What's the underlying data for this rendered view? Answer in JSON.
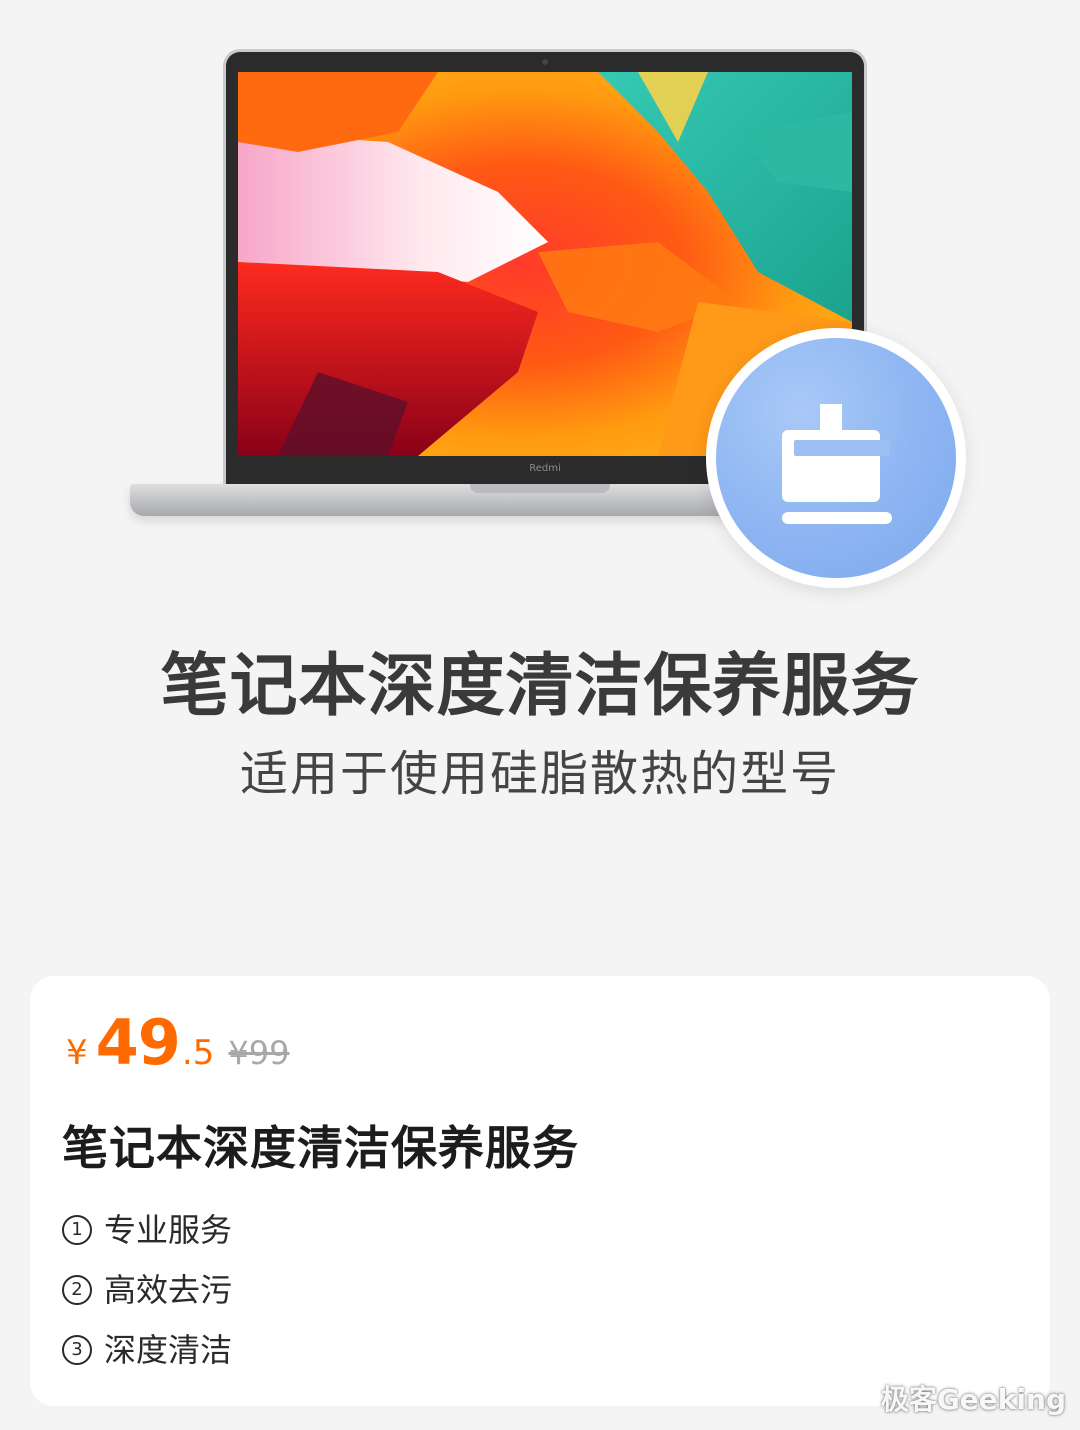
{
  "hero": {
    "title": "笔记本深度清洁保养服务",
    "subtitle": "适用于使用硅脂散热的型号",
    "laptop_brand": "Redmi",
    "badge_icon": "broom-icon",
    "badge_color": "#8db5f2"
  },
  "product": {
    "price": {
      "currency": "¥",
      "integer": "49",
      "decimal": ".5",
      "original": "¥99"
    },
    "title": "笔记本深度清洁保养服务",
    "features": [
      {
        "num": "1",
        "label": "专业服务"
      },
      {
        "num": "2",
        "label": "高效去污"
      },
      {
        "num": "3",
        "label": "深度清洁"
      }
    ]
  },
  "colors": {
    "price_accent": "#ff6a00",
    "background": "#f4f4f4",
    "card": "#ffffff"
  },
  "watermark": "极客Geeking"
}
